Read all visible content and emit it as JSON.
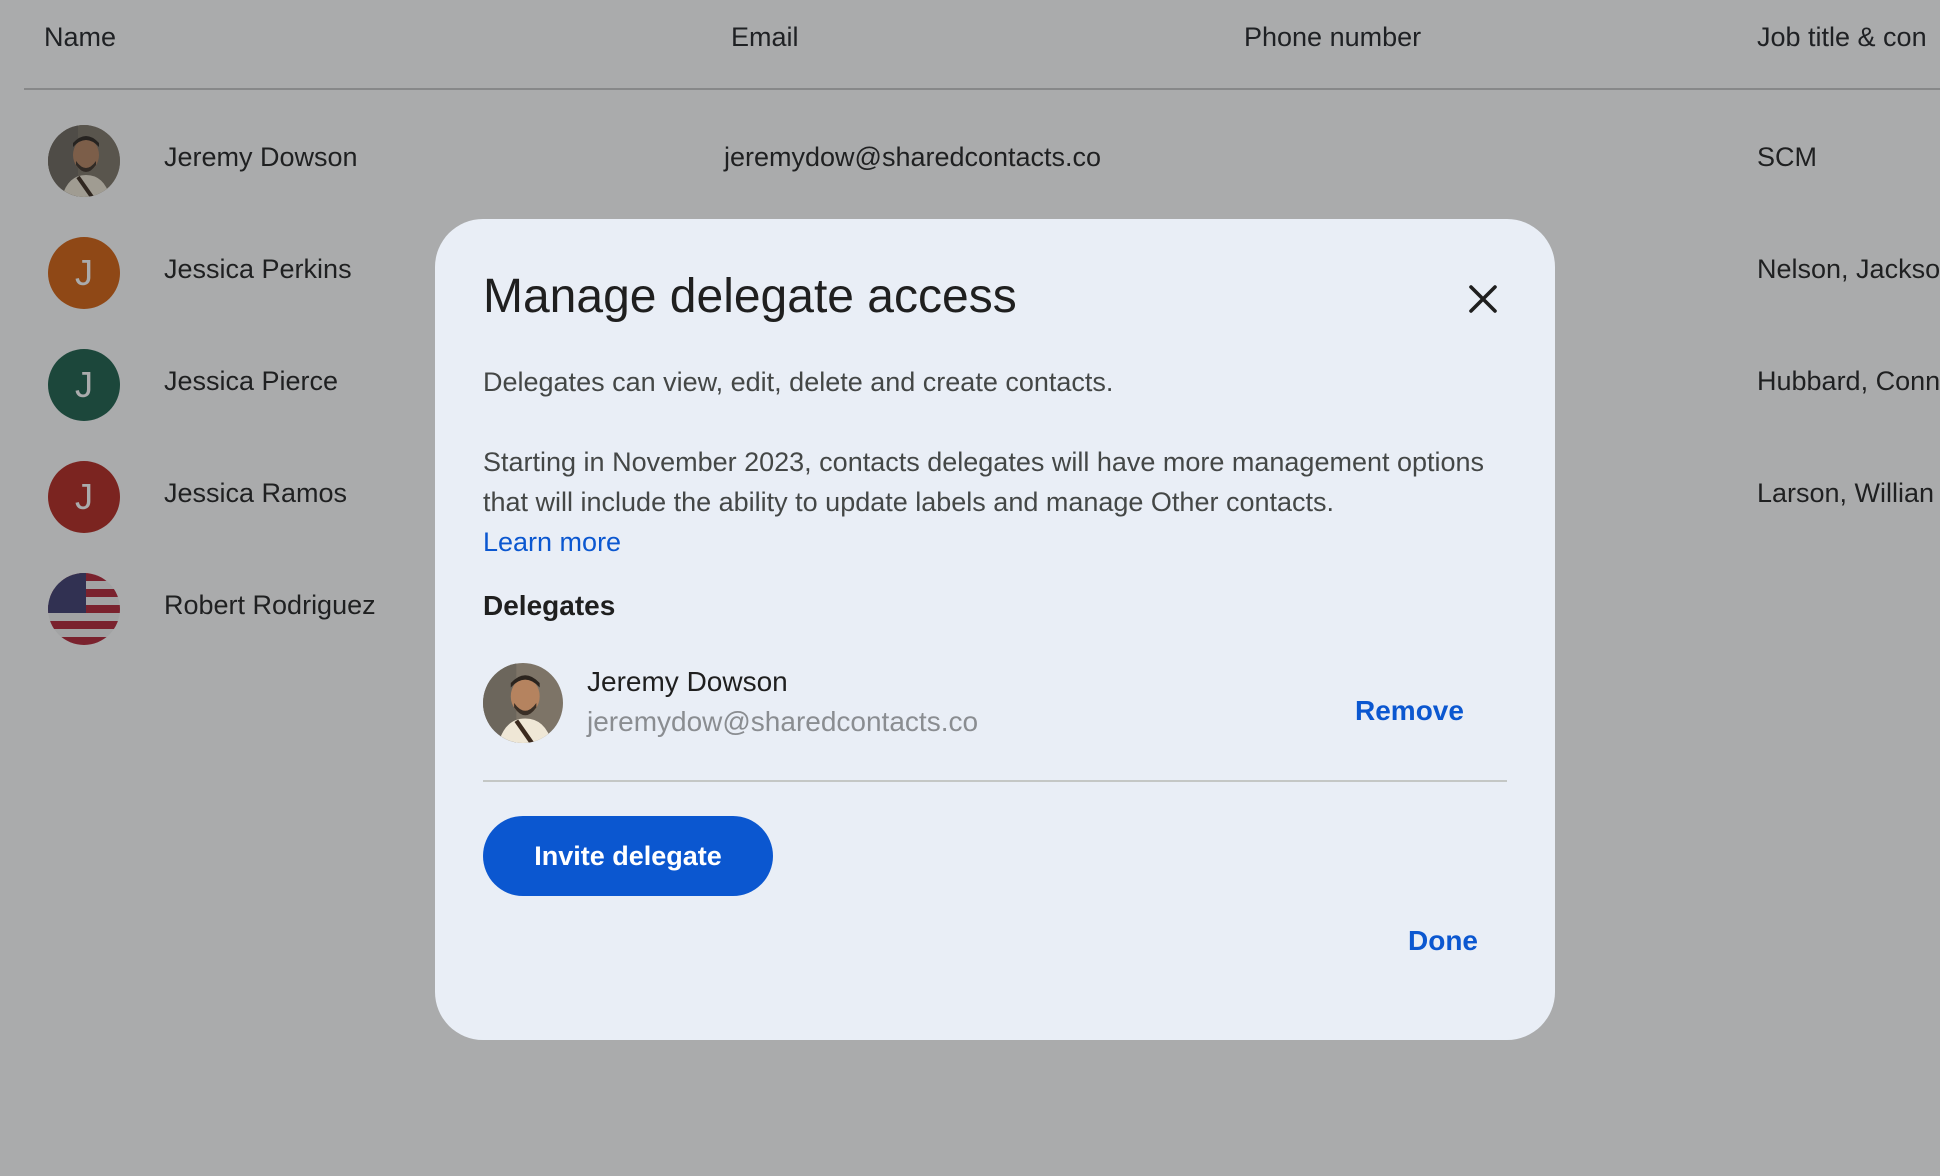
{
  "table": {
    "headers": {
      "name": "Name",
      "email": "Email",
      "phone": "Phone number",
      "job": "Job title & con"
    },
    "rows": [
      {
        "name": "Jeremy Dowson",
        "email": "jeremydow@sharedcontacts.co",
        "job": "SCM",
        "avatar_type": "photo",
        "avatar_color": "#8b8276"
      },
      {
        "name": "Jessica Perkins",
        "email": "",
        "job": "Nelson, Jackso",
        "avatar_type": "initial",
        "initial": "J",
        "avatar_color": "#d35f0e"
      },
      {
        "name": "Jessica Pierce",
        "email": "",
        "job": "Hubbard, Conn",
        "avatar_type": "initial",
        "initial": "J",
        "avatar_color": "#1b5e4a"
      },
      {
        "name": "Jessica Ramos",
        "email": "",
        "job": "Larson, Willian",
        "avatar_type": "initial",
        "initial": "J",
        "avatar_color": "#b3261e"
      },
      {
        "name": "Robert Rodriguez",
        "email": "",
        "job": "",
        "avatar_type": "flag",
        "avatar_color": "#3c3b6e"
      }
    ]
  },
  "dialog": {
    "title": "Manage delegate access",
    "close_icon": "close-icon",
    "description": "Delegates can view, edit, delete and create contacts.",
    "notice": "Starting in November 2023, contacts delegates will have more management options that will include the ability to update labels and manage Other contacts.",
    "learn_more": "Learn more",
    "delegates_label": "Delegates",
    "delegates": [
      {
        "name": "Jeremy Dowson",
        "email": "jeremydow@sharedcontacts.co",
        "remove_label": "Remove"
      }
    ],
    "invite_label": "Invite delegate",
    "done_label": "Done"
  },
  "colors": {
    "accent": "#0b57d0",
    "dialog_bg": "#e9eef6",
    "scrim": "rgba(32,33,36,0.38)"
  }
}
